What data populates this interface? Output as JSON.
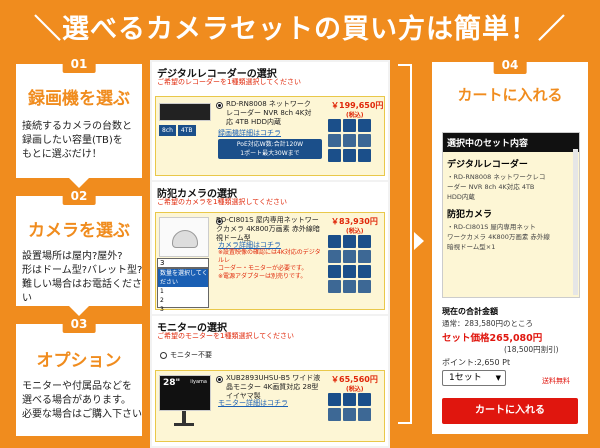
{
  "header": {
    "title": "＼選べるカメラセットの買い方は簡単！／"
  },
  "steps": [
    {
      "num": "01",
      "title": "録画機を選ぶ",
      "desc": [
        "接続するカメラの台数と",
        "録画したい容量(TB)を",
        "もとに選ぶだけ！"
      ]
    },
    {
      "num": "02",
      "title": "カメラを選ぶ",
      "desc": [
        "設置場所は屋内?屋外?",
        "形はドーム型?バレット型?",
        "難しい場合はお電話ください"
      ]
    },
    {
      "num": "03",
      "title": "オプション",
      "desc": [
        "モニターや付属品などを",
        "選べる場合があります。",
        "必要な場合はご購入下さい"
      ]
    }
  ],
  "recorder": {
    "title": "デジタルレコーダーの選択",
    "note": "ご希望のレコーダーを1種類選択してください",
    "name": "RD-RN8008 ネットワークレコーダー NVR 8ch 4K対応 4TB HDD内蔵",
    "price": "￥199,650円",
    "price_sub": "(税込)",
    "link": "録画機詳細はコチラ",
    "poe": [
      "PoE対応W数:合計120W",
      "1ポート最大30Wまで"
    ],
    "badges": [
      "8ch",
      "4TB",
      "8ch",
      "4K"
    ]
  },
  "camera": {
    "title": "防犯カメラの選択",
    "note": "ご希望のカメラを1種類選択してください",
    "name": "RD-CI801S 屋内専用ネットワークカメラ 4K800万画素 赤外線暗視ドーム型",
    "price": "￥83,930円",
    "price_sub": "(税込)",
    "link": "カメラ詳細はコチラ",
    "warn": [
      "※設置映像の確認には4K対応のデジタルレ",
      "コーダー・モニターが必要です。",
      "※電源アダプターは別売りです。"
    ],
    "qty_selected": "3",
    "qty_header": "数量を選択してください",
    "qty_options": [
      "1",
      "2",
      "3"
    ],
    "brand": "RD-CI801S"
  },
  "monitor": {
    "title": "モニターの選択",
    "note": "ご希望のモニターを1種類選択してください",
    "none": "モニター不要",
    "name": "XUB2893UHSU-B5 ワイド液晶モニター 4K画質対応 28型 イイヤマ製",
    "price": "￥65,560円",
    "price_sub": "(税込)",
    "link": "モニター詳細はコチラ",
    "size": "28\"",
    "brand": "iiyama"
  },
  "cart": {
    "num": "04",
    "title": "カートに入れる",
    "box_title": "選択中のセット内容",
    "rec_title": "デジタルレコーダー",
    "rec_lines": [
      "・RD-RN8008 ネットワークレコ",
      "ーダー NVR 8ch 4K対応 4TB",
      "HDD内蔵"
    ],
    "cam_title": "防犯カメラ",
    "cam_lines": [
      "・RD-CI801S 屋内専用ネット",
      "ワークカメラ 4K800万画素 赤外線",
      "暗視ドーム型×1"
    ],
    "total_label": "現在の合計金額",
    "normal": "通常：283,580円のところ",
    "set_price": "セット価格265,080円",
    "discount": "(18,500円割引)",
    "point": "ポイント:2,650 Pt",
    "qty": "1セット",
    "shipping": "送料無料",
    "button": "カートに入れる"
  }
}
